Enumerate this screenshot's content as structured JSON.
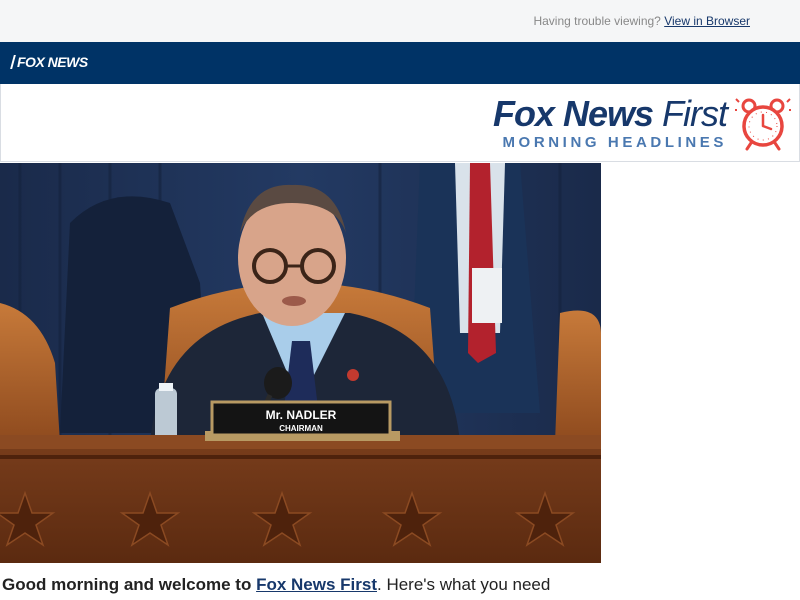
{
  "topbar": {
    "trouble_text": "Having trouble viewing?",
    "view_link": "View in Browser"
  },
  "navbar": {
    "logo_text": "FOX NEWS"
  },
  "header": {
    "brand_bold": "Fox News",
    "brand_light": "First",
    "subtitle": "MORNING HEADLINES"
  },
  "hero": {
    "nameplate_name": "Mr. NADLER",
    "nameplate_title": "CHAIRMAN"
  },
  "intro": {
    "lead": "Good morning and welcome to",
    "link": "Fox News First",
    "rest": ". Here's what you need"
  },
  "colors": {
    "navy": "#003366",
    "brand_blue": "#17386b",
    "sub_blue": "#4a78b0",
    "alarm_red": "#e8463f"
  }
}
